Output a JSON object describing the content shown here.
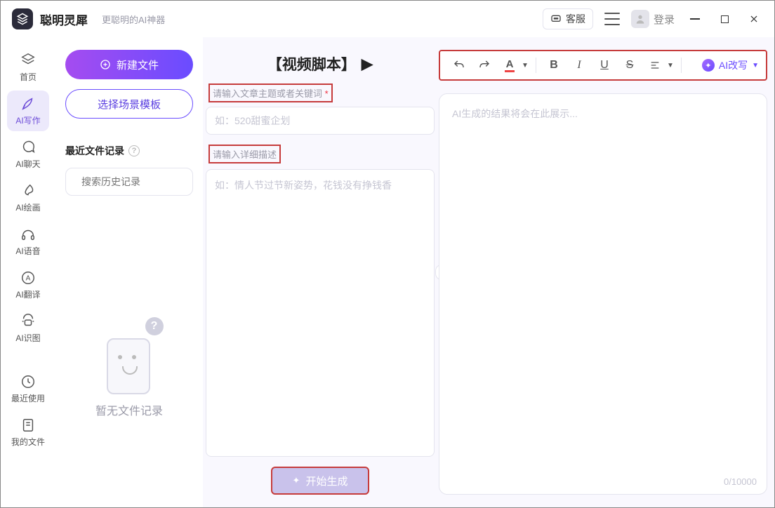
{
  "titlebar": {
    "app_name": "聪明灵犀",
    "tagline": "更聪明的AI神器",
    "customer_service": "客服",
    "login": "登录"
  },
  "sidebar": {
    "items": [
      {
        "id": "home",
        "label": "首页"
      },
      {
        "id": "write",
        "label": "AI写作"
      },
      {
        "id": "chat",
        "label": "AI聊天"
      },
      {
        "id": "paint",
        "label": "AI绘画"
      },
      {
        "id": "voice",
        "label": "AI语音"
      },
      {
        "id": "translate",
        "label": "AI翻译"
      },
      {
        "id": "vision",
        "label": "AI识图"
      },
      {
        "id": "recent",
        "label": "最近使用"
      },
      {
        "id": "myfiles",
        "label": "我的文件"
      }
    ]
  },
  "files": {
    "new_button": "新建文件",
    "template_button": "选择场景模板",
    "history_title": "最近文件记录",
    "search_placeholder": "搜索历史记录",
    "empty_text": "暂无文件记录"
  },
  "form": {
    "page_title": "【视频脚本】",
    "field1_label": "请输入文章主题或者关键词",
    "field1_placeholder": "如：520甜蜜企划",
    "field2_label": "请输入详细描述",
    "field2_placeholder": "如：情人节过节新姿势，花钱没有挣钱香",
    "generate": "开始生成"
  },
  "result": {
    "placeholder": "AI生成的结果将会在此展示...",
    "count": "0/10000",
    "ai_rewrite": "AI改写"
  }
}
